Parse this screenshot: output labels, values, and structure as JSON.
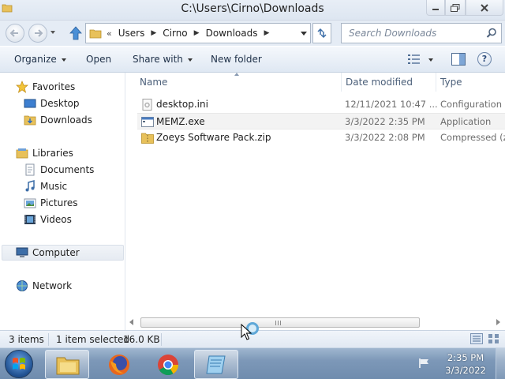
{
  "window": {
    "title": "C:\\Users\\Cirno\\Downloads"
  },
  "address": {
    "chevron": "«",
    "crumbs": [
      "Users",
      "Cirno",
      "Downloads"
    ],
    "search_placeholder": "Search Downloads"
  },
  "commands": {
    "organize": "Organize",
    "open": "Open",
    "share_with": "Share with",
    "new_folder": "New folder",
    "help": "?"
  },
  "navigation": {
    "favorites": "Favorites",
    "desktop": "Desktop",
    "downloads": "Downloads",
    "libraries": "Libraries",
    "documents": "Documents",
    "music": "Music",
    "pictures": "Pictures",
    "videos": "Videos",
    "computer": "Computer",
    "network": "Network"
  },
  "columns": {
    "name": "Name",
    "date_modified": "Date modified",
    "type": "Type"
  },
  "files": [
    {
      "name": "desktop.ini",
      "date": "12/11/2021 10:47 ...",
      "type": "Configuration s",
      "icon": "config-file-icon"
    },
    {
      "name": "MEMZ.exe",
      "date": "3/3/2022 2:35 PM",
      "type": "Application",
      "icon": "exe-file-icon"
    },
    {
      "name": "Zoeys Software Pack.zip",
      "date": "3/3/2022 2:08 PM",
      "type": "Compressed (zi",
      "icon": "zip-folder-icon"
    }
  ],
  "status": {
    "items_count": "3 items",
    "selected": "1 item selected",
    "size": "16.0 KB"
  },
  "taskbar": {
    "apps": [
      "windows-explorer",
      "firefox",
      "chrome",
      "notepad"
    ],
    "clock_time": "2:35 PM",
    "clock_date": "3/3/2022"
  },
  "colors": {
    "accent": "#3f7fc4",
    "taskbar": "#7d98b8",
    "selection": "#f3f3f3"
  }
}
